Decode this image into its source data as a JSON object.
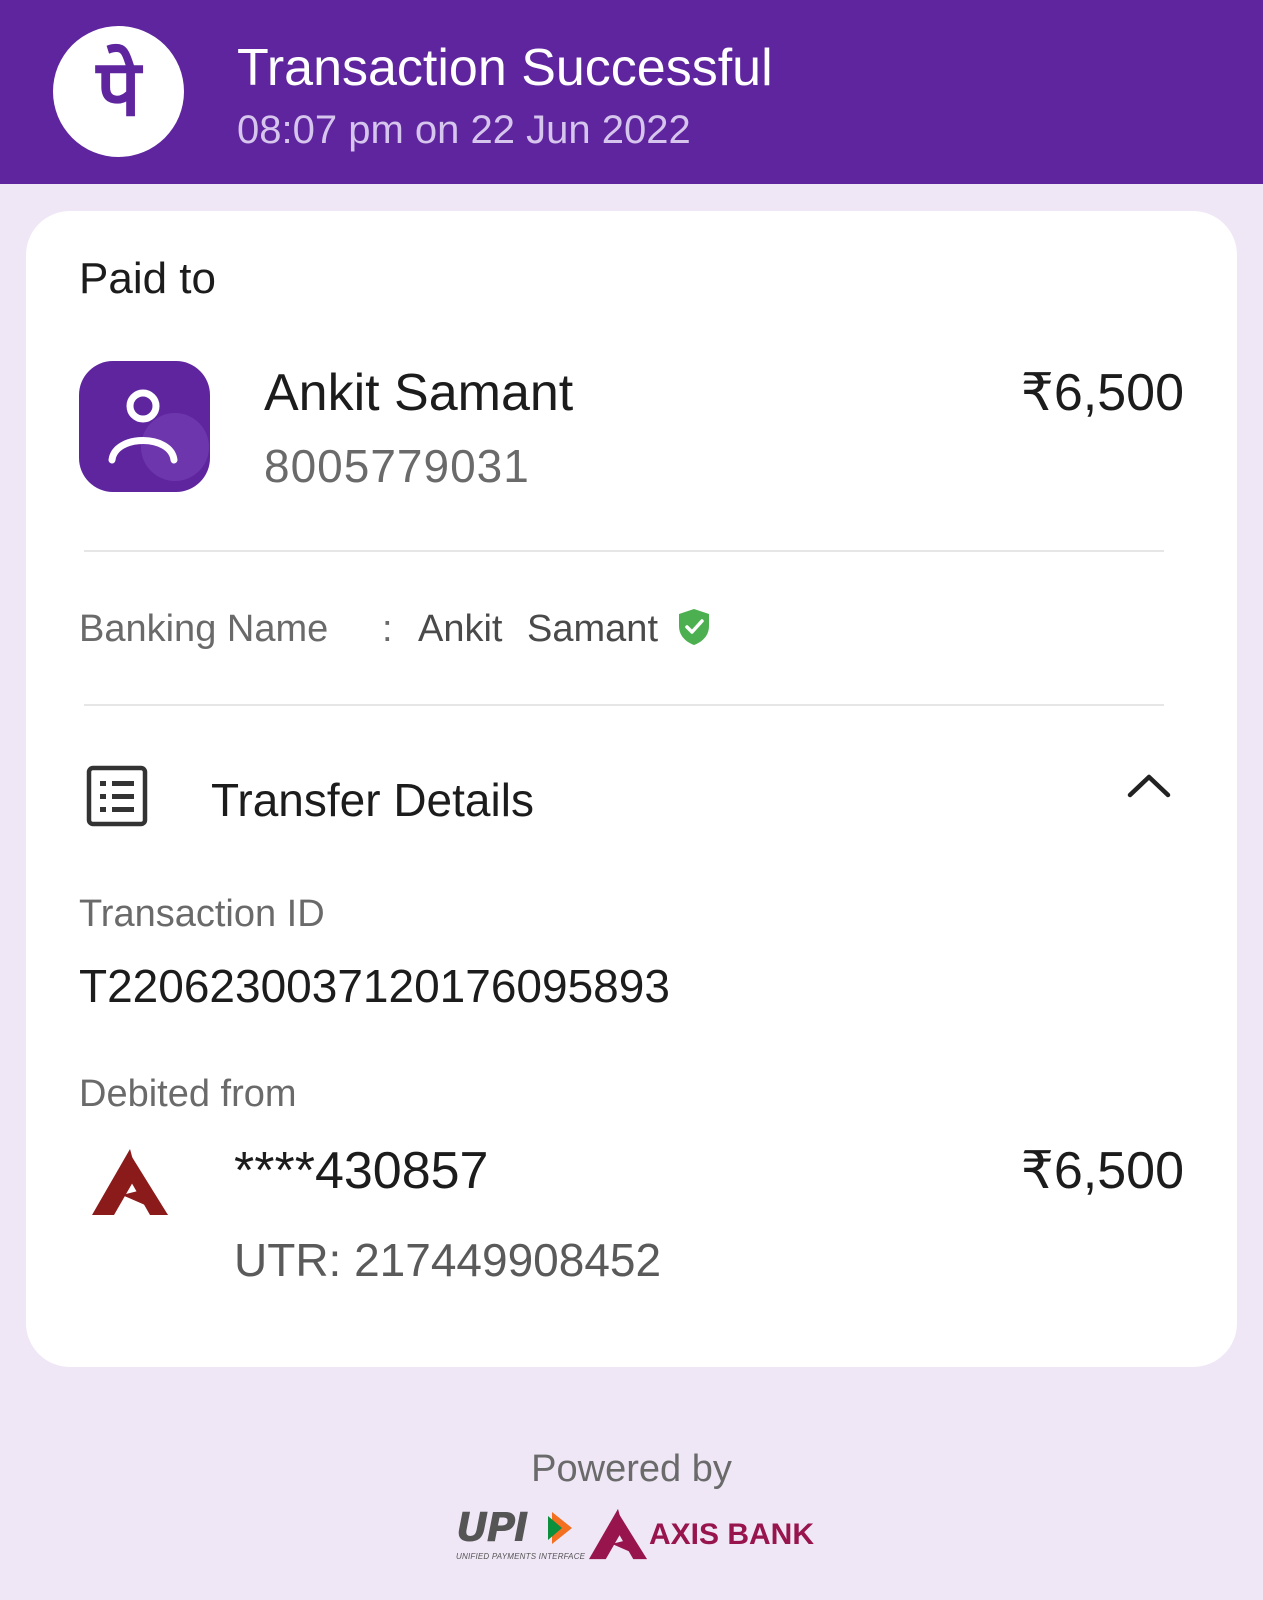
{
  "header": {
    "logo_glyph": "पे",
    "title": "Transaction Successful",
    "timestamp": "08:07 pm on 22 Jun 2022"
  },
  "payee": {
    "section_label": "Paid to",
    "name": "Ankit Samant",
    "phone": "8005779031",
    "amount": "₹6,500"
  },
  "banking_name": {
    "label": "Banking Name",
    "separator": ":",
    "value": "Ankit Samant",
    "verified_icon": "verified-shield-icon"
  },
  "transfer_details": {
    "title": "Transfer Details",
    "icon": "receipt-list-icon",
    "toggle_icon": "chevron-up-icon",
    "transaction_id_label": "Transaction ID",
    "transaction_id": "T2206230037120176095893",
    "debited_from_label": "Debited from",
    "account": "****430857",
    "debit_amount": "₹6,500",
    "utr": "UTR: 217449908452"
  },
  "footer": {
    "powered_by": "Powered by",
    "upi_logo_text": "UPI",
    "upi_subtext": "UNIFIED PAYMENTS INTERFACE",
    "bank_logo_text": "AXIS BANK"
  },
  "colors": {
    "brand_purple": "#5f259f",
    "page_background": "#efe6f6",
    "axis_maroon": "#97144d",
    "verified_green": "#4caf50"
  }
}
